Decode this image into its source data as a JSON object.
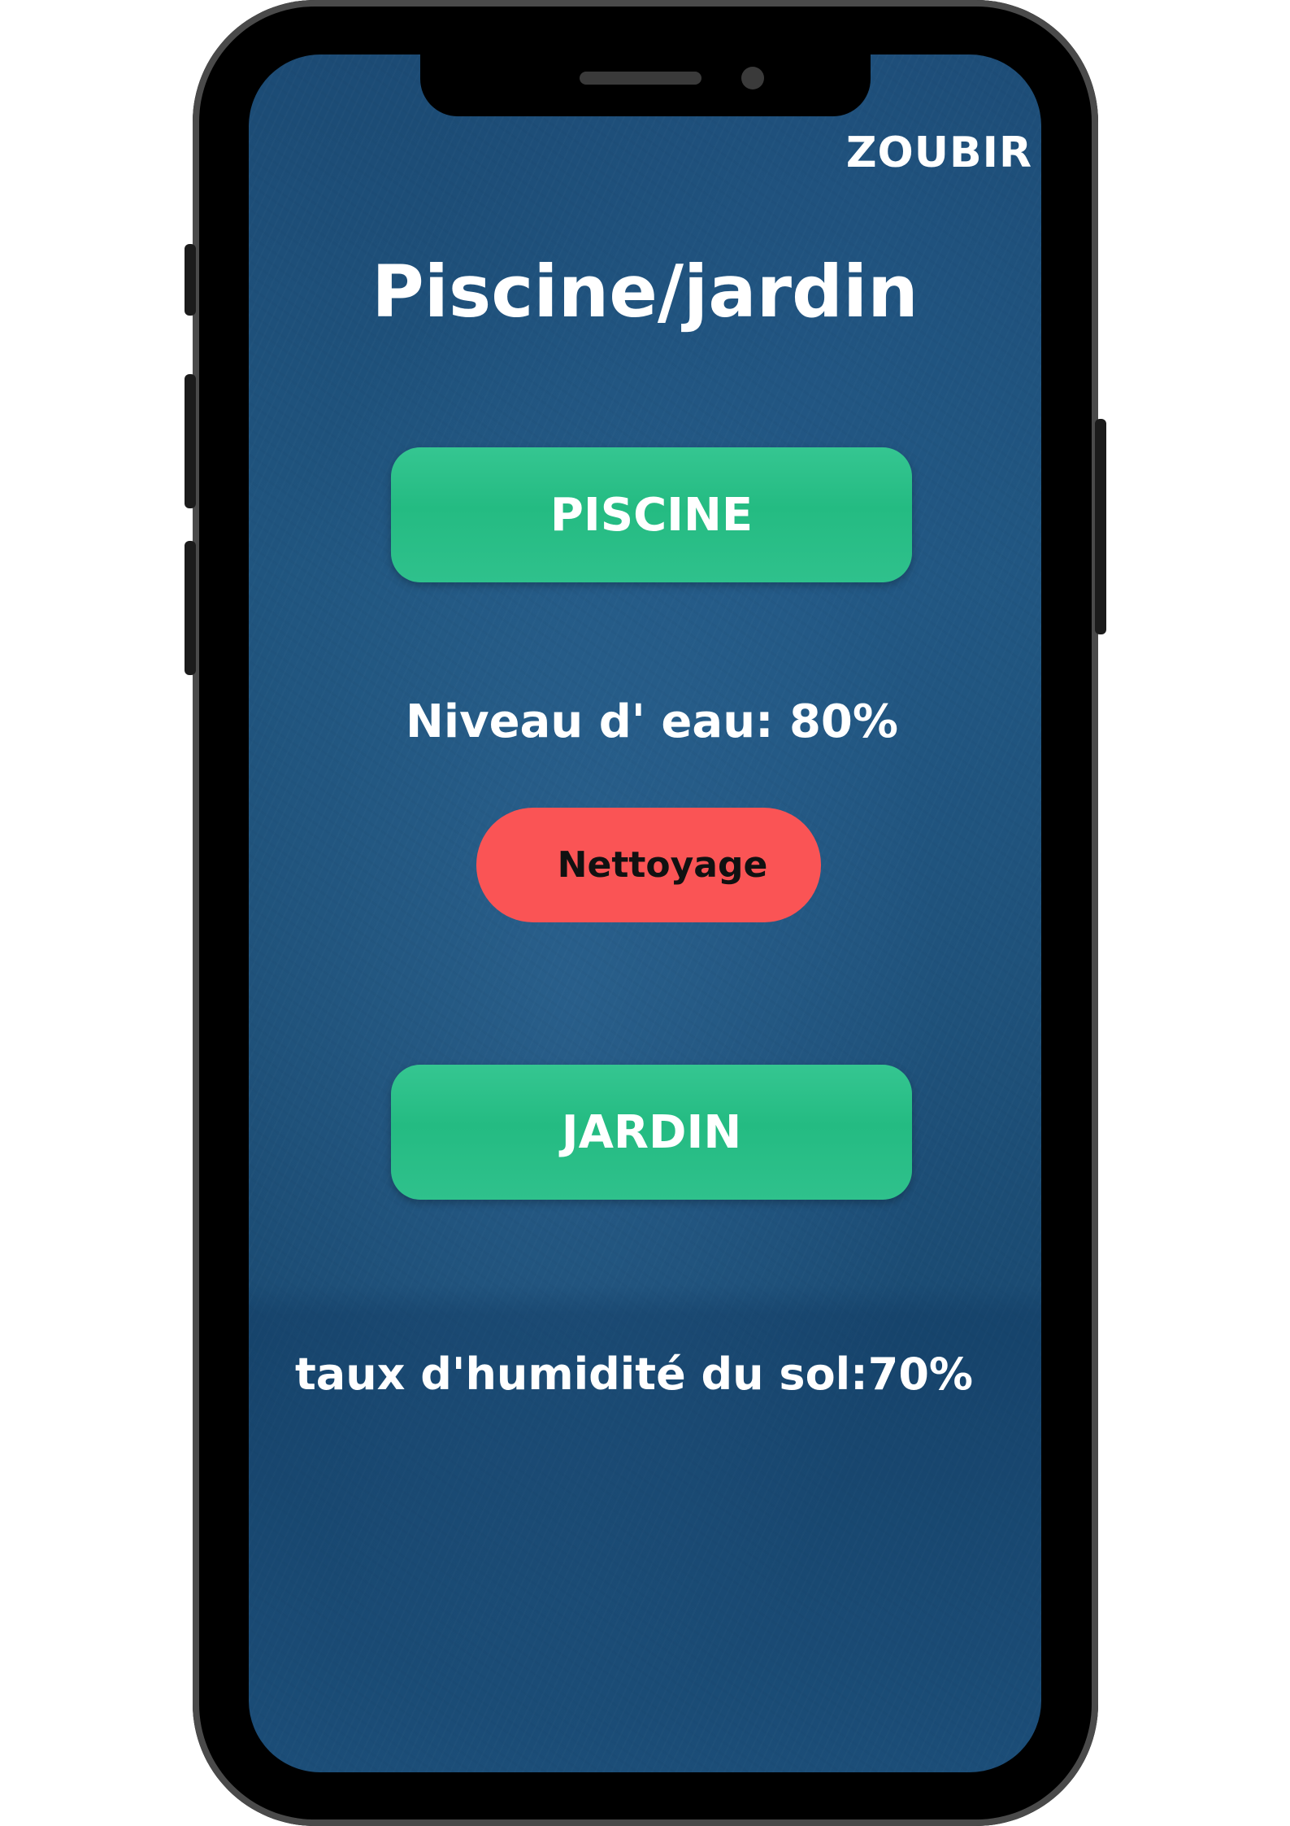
{
  "header": {
    "user_name": "ZOUBIR",
    "title": "Piscine/jardin"
  },
  "piscine": {
    "button_label": "PISCINE",
    "water_level_text": "Niveau d' eau: 80%",
    "water_level_percent": 80,
    "cleaning_button_label": "Nettoyage"
  },
  "jardin": {
    "button_label": "JARDIN",
    "soil_humidity_text": "taux d'humidité du sol:70%",
    "soil_humidity_percent": 70
  },
  "colors": {
    "screen_background": "#1e5078",
    "primary_button": "#2bbe87",
    "cleaning_button": "#fa5455",
    "text": "#ffffff"
  }
}
